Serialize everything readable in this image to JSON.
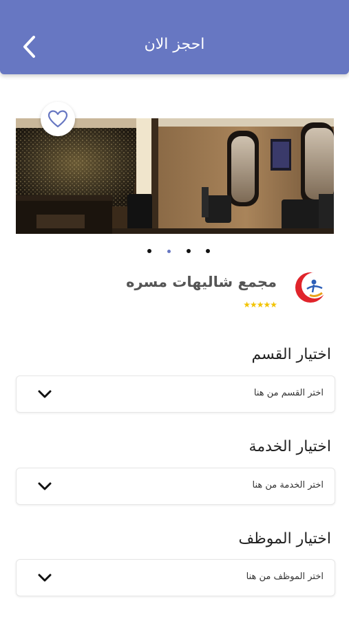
{
  "header": {
    "title": "احجز الان",
    "back_icon": "chevron-left-icon",
    "background": "#6777c2"
  },
  "carousel": {
    "slide_count": 4,
    "active_index": 1,
    "favorite_icon": "heart-outline-icon"
  },
  "salon": {
    "name": "مجمع شاليهات مسره",
    "rating": 5,
    "stars": "★★★★★",
    "logo_icon": "crescent-logo-icon"
  },
  "form": {
    "department": {
      "label": "اختيار القسم",
      "placeholder": "اختر القسم من هنا"
    },
    "service": {
      "label": "اختيار الخدمة",
      "placeholder": "اختر الخدمة من هنا"
    },
    "employee": {
      "label": "اختيار الموظف",
      "placeholder": "اختر الموظف من هنا"
    }
  },
  "colors": {
    "accent": "#6777c2",
    "star": "#f2c300"
  }
}
